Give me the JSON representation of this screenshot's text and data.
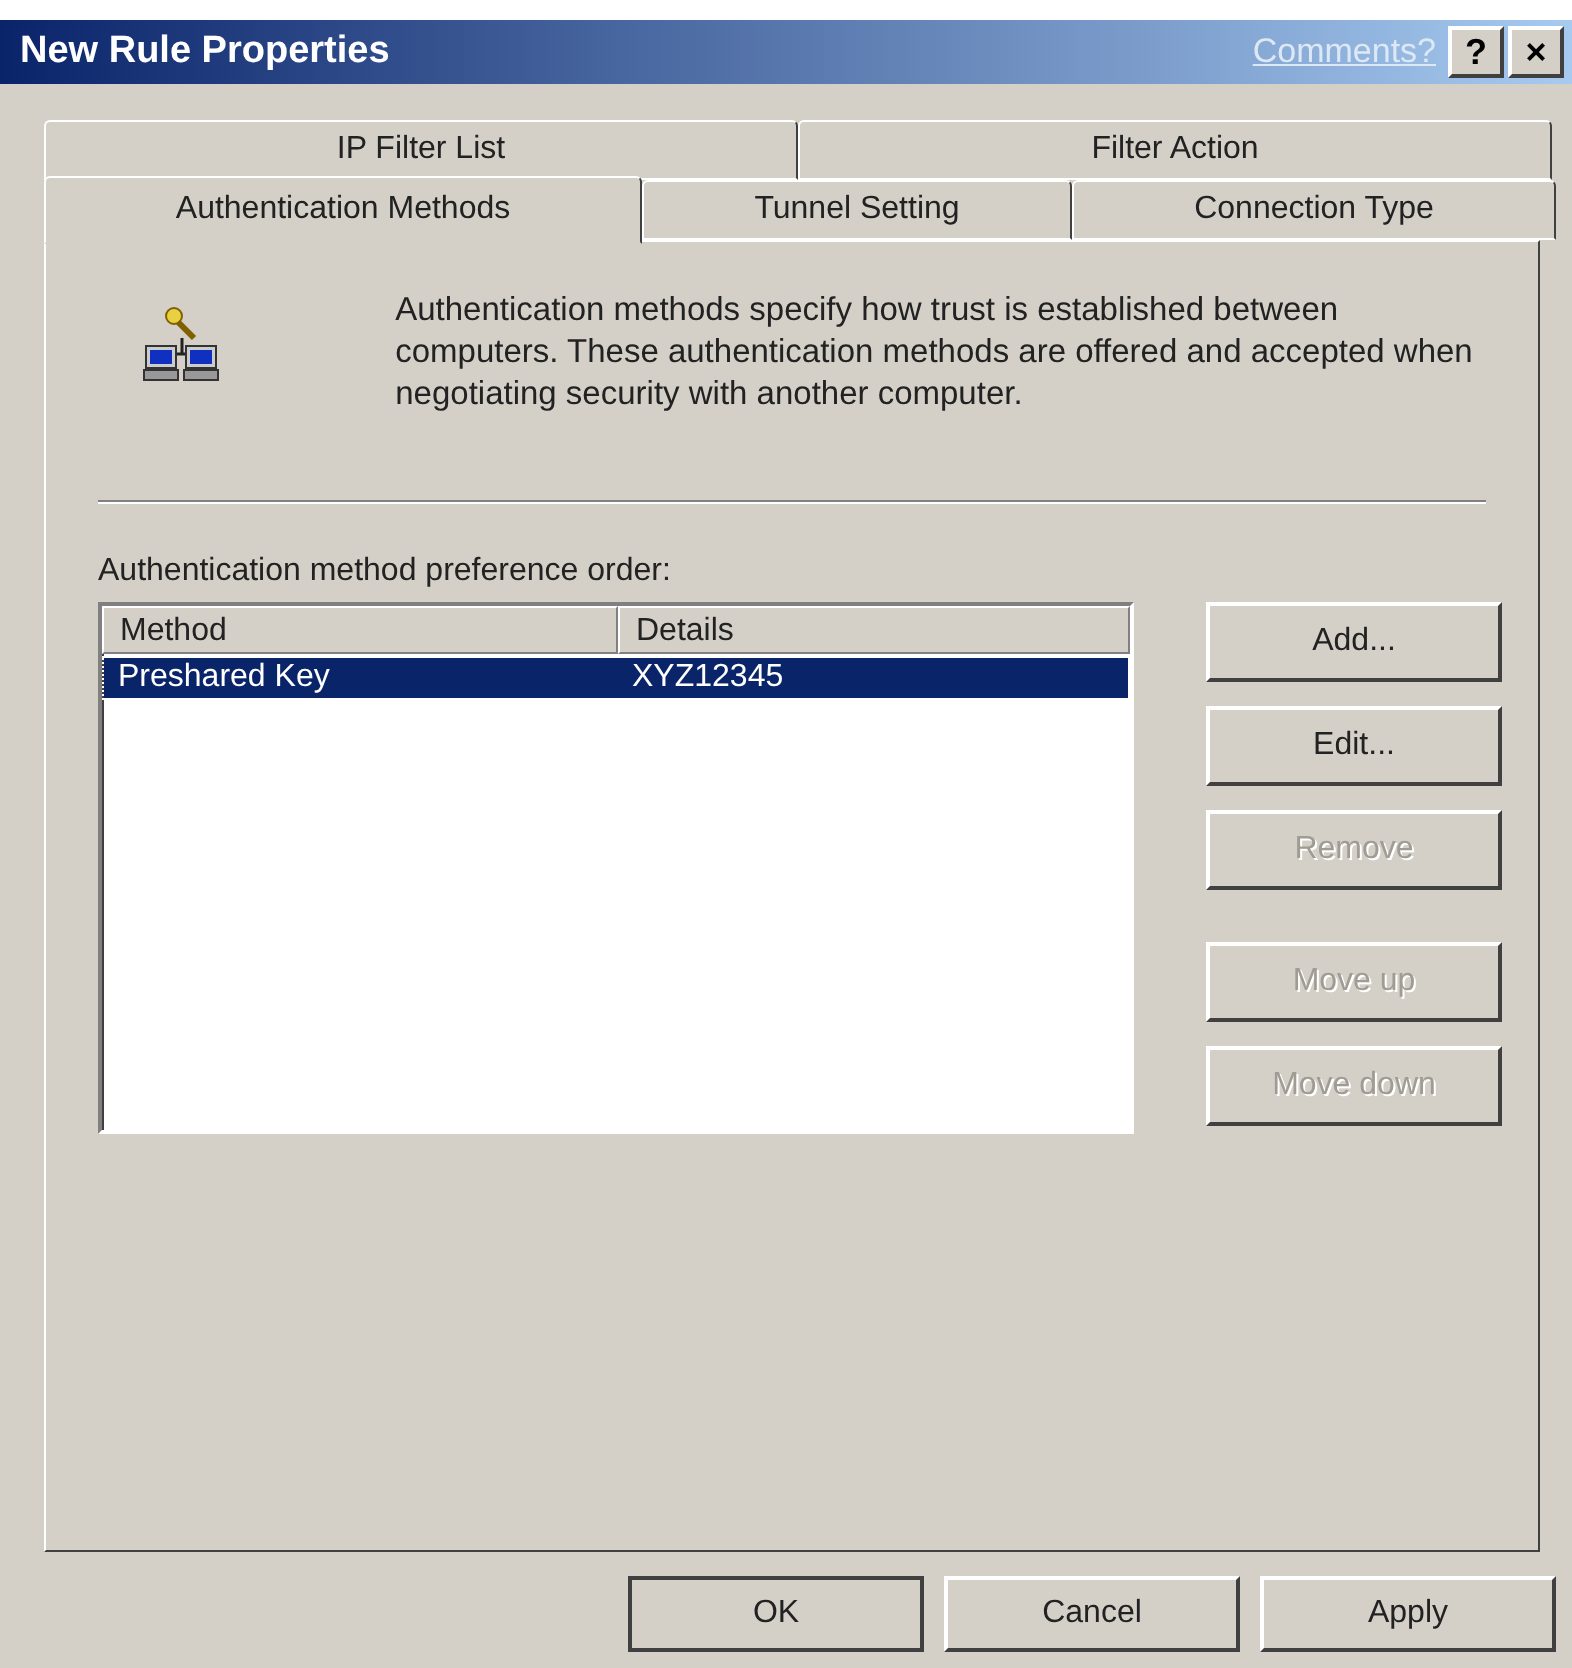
{
  "window": {
    "title": "New Rule Properties",
    "comments_link": "Comments?",
    "help_button": "?",
    "close_button": "×"
  },
  "tab_rows": [
    [
      {
        "label": "IP Filter List",
        "selected": false
      },
      {
        "label": "Filter Action",
        "selected": false
      }
    ],
    [
      {
        "label": "Authentication Methods",
        "selected": true
      },
      {
        "label": "Tunnel Setting",
        "selected": false
      },
      {
        "label": "Connection Type",
        "selected": false
      }
    ]
  ],
  "description": "Authentication methods specify how trust is established between computers. These authentication methods are offered and accepted when negotiating security with another computer.",
  "list_label": "Authentication method preference order:",
  "table": {
    "columns": [
      "Method",
      "Details"
    ],
    "rows": [
      {
        "cells": [
          "Preshared Key",
          "XYZ12345"
        ],
        "selected": true
      }
    ]
  },
  "side_buttons": [
    {
      "label": "Add...",
      "disabled": false
    },
    {
      "label": "Edit...",
      "disabled": false
    },
    {
      "label": "Remove",
      "disabled": true
    },
    {
      "label": "Move up",
      "disabled": true
    },
    {
      "label": "Move down",
      "disabled": true
    }
  ],
  "footer_buttons": [
    {
      "label": "OK",
      "default": true
    },
    {
      "label": "Cancel",
      "default": false
    },
    {
      "label": "Apply",
      "default": false
    }
  ]
}
